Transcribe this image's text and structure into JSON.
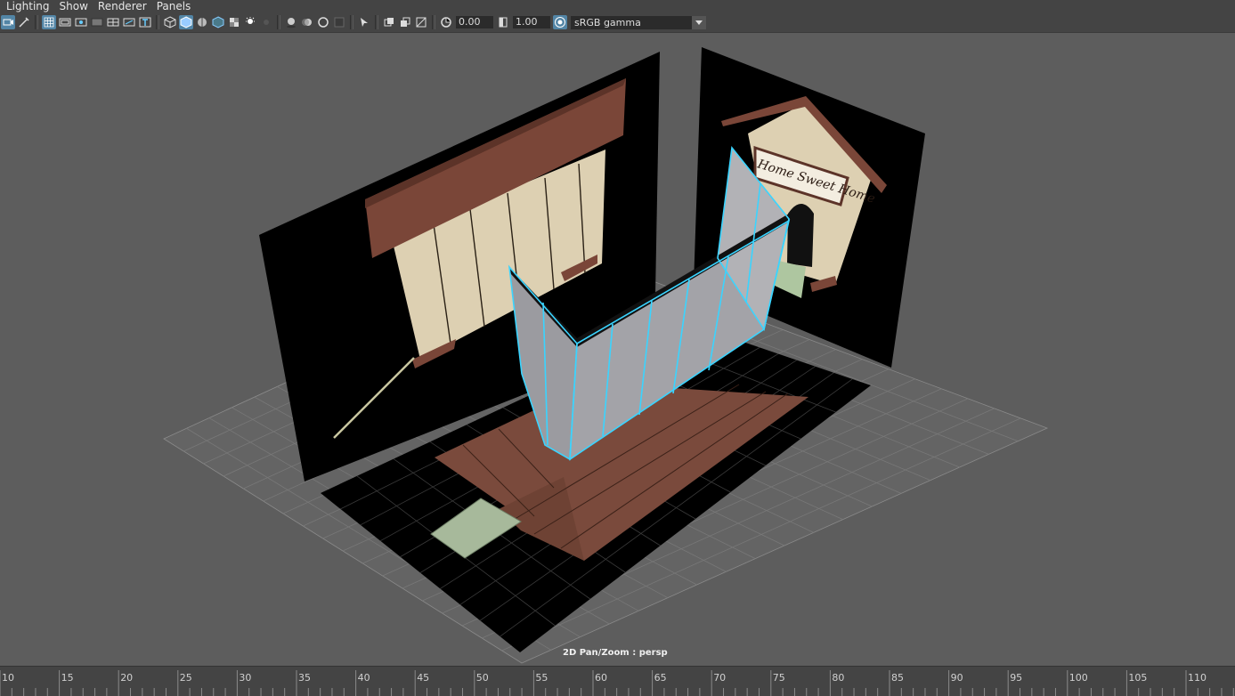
{
  "menu": [
    "Lighting",
    "Show",
    "Renderer",
    "Panels"
  ],
  "toolbar": {
    "exposure": "0.00",
    "gamma": "1.00",
    "colorspace": "sRGB gamma",
    "icons": [
      "select-camera-icon",
      "camera-attributes-icon",
      "grid-icon",
      "film-gate-icon",
      "resolution-gate-icon",
      "gate-mask-icon",
      "field-chart-icon",
      "safe-action-icon",
      "safe-title-icon",
      "wireframe-icon",
      "smooth-shade-icon",
      "wireframe-on-shaded-icon",
      "default-material-icon",
      "textured-icon",
      "use-all-lights-icon",
      "shadows-icon",
      "screen-space-ao-icon",
      "motion-blur-icon",
      "multisample-aa-icon",
      "depth-of-field-icon",
      "isolate-select-icon",
      "xray-icon",
      "xray-joints-icon",
      "backface-culling-icon",
      "exposure-icon",
      "gamma-icon",
      "color-management-icon"
    ]
  },
  "viewport": {
    "hud_label": "2D Pan/Zoom : persp",
    "sign_text": "Home Sweet Home"
  },
  "timeline": {
    "ticks": [
      "10",
      "15",
      "20",
      "25",
      "30",
      "35",
      "40",
      "45",
      "50",
      "55",
      "60",
      "65",
      "70",
      "75",
      "80",
      "85",
      "90",
      "95",
      "100",
      "105",
      "110"
    ]
  }
}
